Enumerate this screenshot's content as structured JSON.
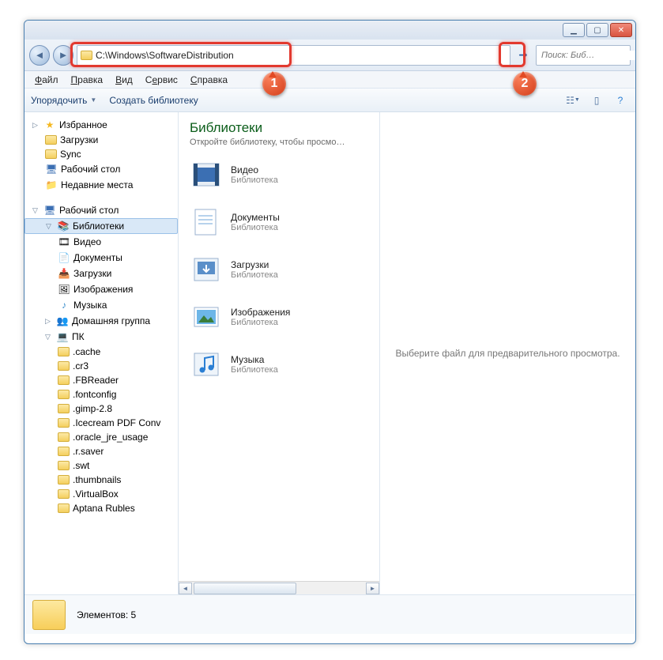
{
  "address_path": "C:\\Windows\\SoftwareDistribution",
  "search_placeholder": "Поиск: Биб…",
  "menu": {
    "file": "Файл",
    "edit": "Правка",
    "view": "Вид",
    "tools": "Сервис",
    "help": "Справка"
  },
  "toolbar": {
    "organize": "Упорядочить",
    "newlib": "Создать библиотеку"
  },
  "sidebar": {
    "favorites": "Избранное",
    "fav_items": [
      "Загрузки",
      "Sync",
      "Рабочий стол",
      "Недавние места"
    ],
    "desktop": "Рабочий стол",
    "libraries": "Библиотеки",
    "lib_items": [
      "Видео",
      "Документы",
      "Загрузки",
      "Изображения",
      "Музыка"
    ],
    "homegroup": "Домашняя группа",
    "pc": "ПК",
    "pc_items": [
      ".cache",
      ".cr3",
      ".FBReader",
      ".fontconfig",
      ".gimp-2.8",
      ".Icecream PDF Conv",
      ".oracle_jre_usage",
      ".r.saver",
      ".swt",
      ".thumbnails",
      ".VirtualBox",
      "Aptana Rubles"
    ]
  },
  "content": {
    "heading": "Библиотеки",
    "sub": "Откройте библиотеку, чтобы просмо…",
    "items": [
      {
        "name": "Видео",
        "type": "Библиотека"
      },
      {
        "name": "Документы",
        "type": "Библиотека"
      },
      {
        "name": "Загрузки",
        "type": "Библиотека"
      },
      {
        "name": "Изображения",
        "type": "Библиотека"
      },
      {
        "name": "Музыка",
        "type": "Библиотека"
      }
    ]
  },
  "preview_placeholder": "Выберите файл для предварительного просмотра.",
  "status": {
    "label": "Элементов:",
    "count": "5"
  },
  "callouts": {
    "c1": "1",
    "c2": "2"
  }
}
